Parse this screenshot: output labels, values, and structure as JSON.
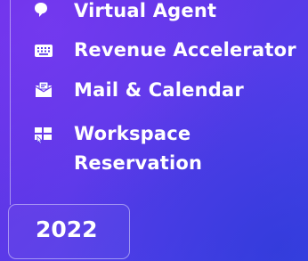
{
  "menu": {
    "items": [
      {
        "label": "Virtual Agent",
        "icon": "chat-bot-icon"
      },
      {
        "label": "Revenue Accelerator",
        "icon": "keyboard-icon"
      },
      {
        "label": "Mail & Calendar",
        "icon": "mail-calendar-icon"
      },
      {
        "label": "Workspace Reservation",
        "icon": "workspace-reservation-icon"
      }
    ]
  },
  "year_selector": {
    "label": "2022"
  },
  "colors": {
    "background_top": "#6a2fe6",
    "background_bottom": "#3f44e8",
    "text": "#ffffff"
  }
}
